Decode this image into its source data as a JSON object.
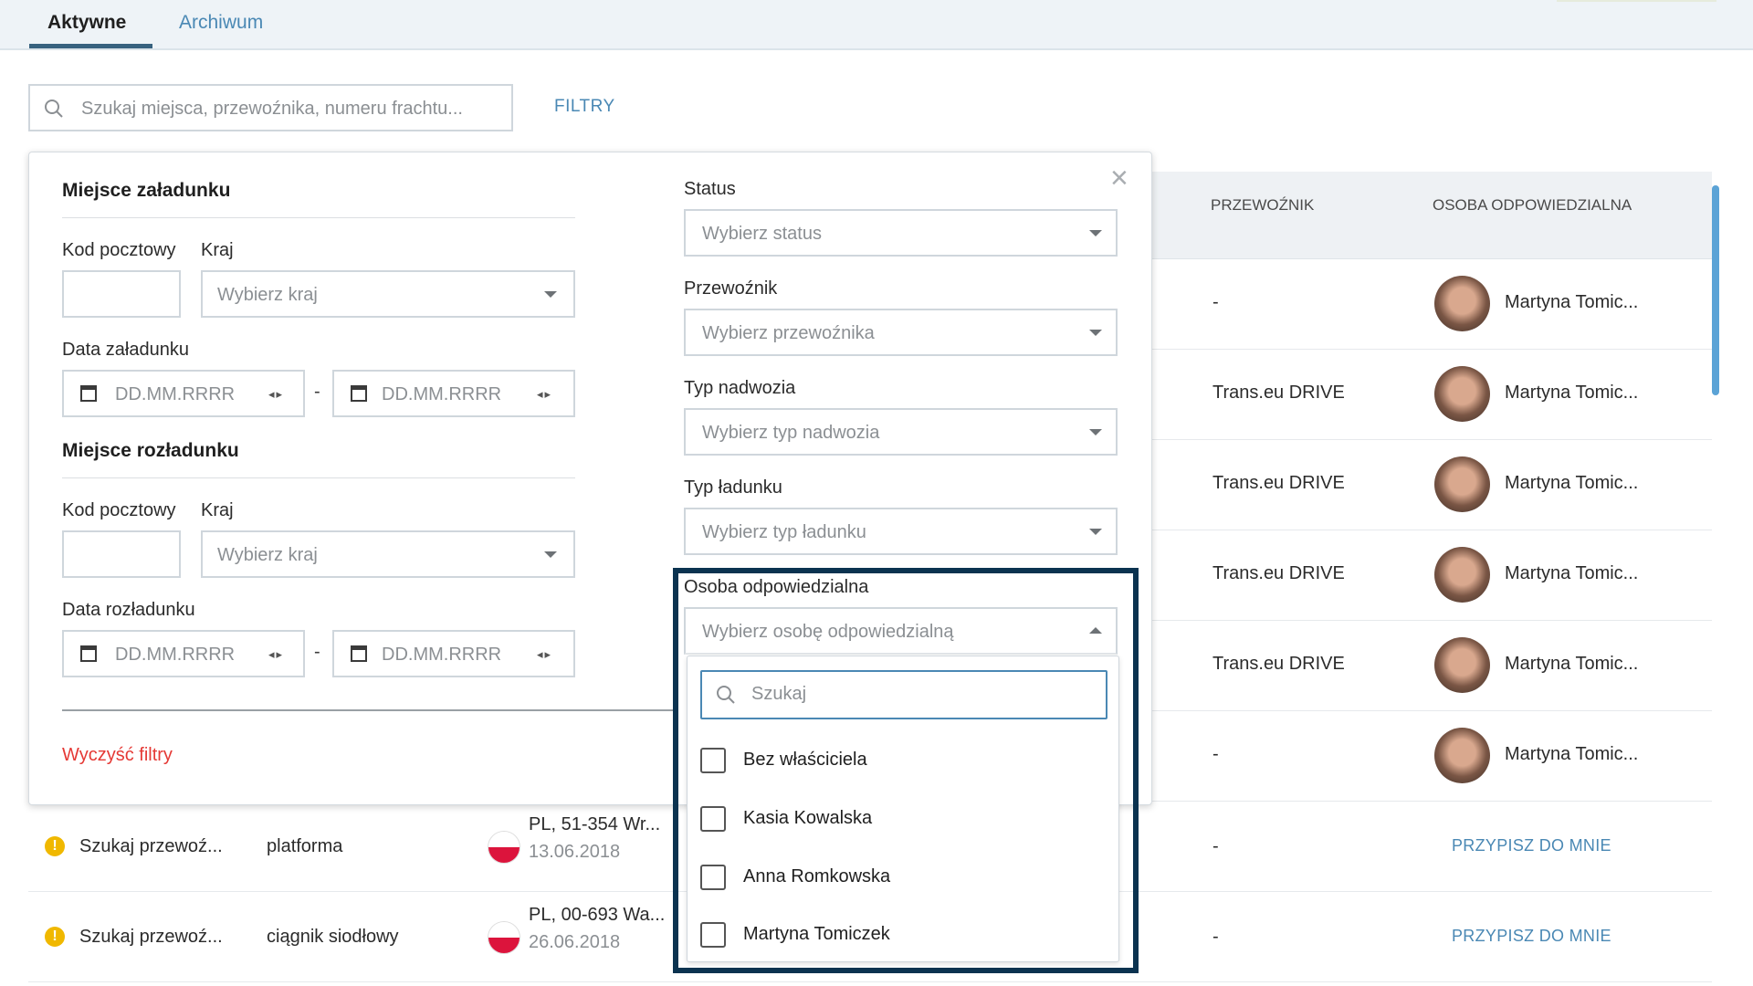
{
  "tabs": {
    "active": "Aktywne",
    "archive": "Archiwum"
  },
  "search": {
    "placeholder": "Szukaj miejsca, przewoźnika, numeru frachtu..."
  },
  "filters_link": "FILTRY",
  "table": {
    "headers": {
      "carrier": "PRZEWOŹNIK",
      "responsible": "OSOBA ODPOWIEDZIALNA"
    },
    "rows": [
      {
        "carrier": "-",
        "person": "Martyna Tomic..."
      },
      {
        "carrier": "Trans.eu DRIVE",
        "person": "Martyna Tomic..."
      },
      {
        "carrier": "Trans.eu DRIVE",
        "person": "Martyna Tomic..."
      },
      {
        "carrier": "Trans.eu DRIVE",
        "person": "Martyna Tomic..."
      },
      {
        "carrier": "Trans.eu DRIVE",
        "person": "Martyna Tomic..."
      },
      {
        "carrier": "-",
        "person": "Martyna Tomic..."
      }
    ],
    "lower_rows": [
      {
        "status": "Szukaj przewoź...",
        "body": "platforma",
        "place": "PL, 51-354 Wr...",
        "date": "13.06.2018",
        "carrier": "-",
        "action": "PRZYPISZ DO MNIE"
      },
      {
        "status": "Szukaj przewoź...",
        "body": "ciągnik siodłowy",
        "place": "PL, 00-693 Wa...",
        "date": "26.06.2018",
        "carrier": "-",
        "action": "PRZYPISZ DO MNIE"
      }
    ]
  },
  "filter_panel": {
    "loading": {
      "title": "Miejsce załadunku",
      "postal_label": "Kod pocztowy",
      "country_label": "Kraj",
      "country_placeholder": "Wybierz kraj",
      "date_label": "Data załadunku",
      "date_placeholder": "DD.MM.RRRR"
    },
    "unloading": {
      "title": "Miejsce rozładunku",
      "postal_label": "Kod pocztowy",
      "country_label": "Kraj",
      "country_placeholder": "Wybierz kraj",
      "date_label": "Data rozładunku",
      "date_placeholder": "DD.MM.RRRR"
    },
    "date_separator": "-",
    "status": {
      "label": "Status",
      "placeholder": "Wybierz status"
    },
    "carrier": {
      "label": "Przewoźnik",
      "placeholder": "Wybierz przewoźnika"
    },
    "body_type": {
      "label": "Typ nadwozia",
      "placeholder": "Wybierz typ nadwozia"
    },
    "cargo_type": {
      "label": "Typ ładunku",
      "placeholder": "Wybierz typ ładunku"
    },
    "responsible": {
      "label": "Osoba odpowiedzialna",
      "placeholder": "Wybierz osobę odpowiedzialną",
      "search_placeholder": "Szukaj",
      "options": [
        "Bez właściciela",
        "Kasia Kowalska",
        "Anna Romkowska",
        "Martyna Tomiczek"
      ]
    },
    "clear_label": "Wyczyść filtry",
    "close_glyph": "×"
  },
  "colors": {
    "accent": "#4a88b4",
    "highlight": "#0b3350",
    "danger": "#e53935",
    "warning": "#f0b800"
  }
}
